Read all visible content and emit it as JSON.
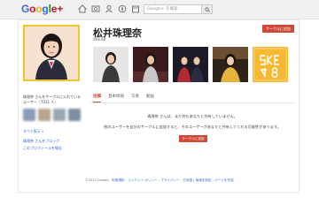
{
  "header": {
    "logo": {
      "G": "G",
      "o1": "o",
      "o2": "o",
      "g": "g",
      "l": "l",
      "e": "e",
      "plus": "+"
    },
    "search_placeholder": "Google+ を検索"
  },
  "profile": {
    "name": "松井珠理奈",
    "subtitle": "SKE48",
    "add_to_circles_button": "サークルに追加"
  },
  "tabs": [
    {
      "label": "投稿",
      "active": true
    },
    {
      "label": "基本情報",
      "active": false
    },
    {
      "label": "写真",
      "active": false
    },
    {
      "label": "動画",
      "active": false
    }
  ],
  "main": {
    "notice": "珠理奈 さんは、まだ何もあなたと共有していません。",
    "prompt": "他のユーザーを自分のサークルに追加すると、そのユーザーがあなたと共有してくれる可能性があります。",
    "add_button": "サークルに追加"
  },
  "sidebar": {
    "circle_text": "珠理奈 さんをサークルに入れているユーザー（7011 人）",
    "see_all": "すべて表示 »",
    "blocked_link": "珠理奈 さんをブロック",
    "report_link": "このプロフィールを報告"
  },
  "footer": {
    "copyright": "©2012 Google - ",
    "links": "利用規約 - コンテンツ ポリシー - プライバシー - 日本語 | 地域を設定 - ページを作成"
  },
  "colors": {
    "accent": "#d14836",
    "link": "#3366cc",
    "photo_border": "#f2c230"
  },
  "icons": [
    "home-icon",
    "photos-icon",
    "profile-icon",
    "explore-icon",
    "events-icon",
    "games-icon",
    "search-icon"
  ]
}
